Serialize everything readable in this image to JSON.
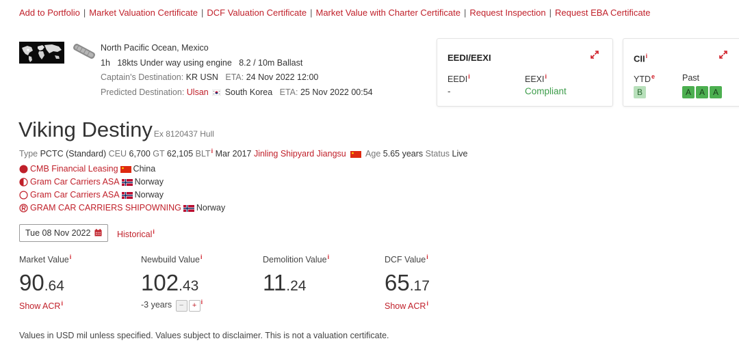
{
  "top_links": [
    "Add to Portfolio",
    "Market Valuation Certificate",
    "DCF Valuation Certificate",
    "Market Value with Charter Certificate",
    "Request Inspection",
    "Request EBA Certificate"
  ],
  "top_links_separator": "|",
  "position": {
    "location": "North Pacific Ocean, Mexico",
    "age": "1h",
    "status_line": "18kts Under way using engine",
    "draught": "8.2 / 10m Ballast",
    "captains_dest_label": "Captain's Destination:",
    "captains_dest_value": "KR USN",
    "captains_eta_label": "ETA:",
    "captains_eta_value": "24 Nov 2022 12:00",
    "predicted_dest_label": "Predicted Destination:",
    "predicted_dest_port": "Ulsan",
    "predicted_dest_country": "South Korea",
    "predicted_eta_label": "ETA:",
    "predicted_eta_value": "25 Nov 2022 00:54"
  },
  "eedi_card": {
    "title": "EEDI/EEXI",
    "eedi_label": "EEDI",
    "eedi_value": "-",
    "eexi_label": "EEXI",
    "eexi_value": "Compliant",
    "compliant_color": "#3d9c4a"
  },
  "cii_card": {
    "title": "CII",
    "ytd_label": "YTD",
    "ytd_grade": "B",
    "past_label": "Past",
    "past_grades": [
      "A",
      "A",
      "A"
    ]
  },
  "vessel": {
    "name": "Viking Destiny",
    "ex_text": "Ex 8120437 Hull",
    "type_label": "Type",
    "type_value": "PCTC (Standard)",
    "ceu_label": "CEU",
    "ceu_value": "6,700",
    "gt_label": "GT",
    "gt_value": "62,105",
    "blt_label": "BLT",
    "blt_value": "Mar 2017",
    "builder": "Jinling Shipyard Jiangsu",
    "age_label": "Age",
    "age_value": "5.65 years",
    "status_label": "Status",
    "status_value": "Live"
  },
  "owners": [
    {
      "role_icon": "registered-owner-icon",
      "name": "CMB Financial Leasing",
      "country": "China",
      "flag": "china-flag"
    },
    {
      "role_icon": "beneficial-owner-icon",
      "name": "Gram Car Carriers ASA",
      "country": "Norway",
      "flag": "norway-flag"
    },
    {
      "role_icon": "operator-icon",
      "name": "Gram Car Carriers ASA",
      "country": "Norway",
      "flag": "norway-flag"
    },
    {
      "role_icon": "manager-icon",
      "name": "GRAM CAR CARRIERS SHIPOWNING",
      "country": "Norway",
      "flag": "norway-flag"
    }
  ],
  "date_selector": {
    "value": "Tue 08 Nov 2022",
    "historical_label": "Historical"
  },
  "values": {
    "market": {
      "label": "Market Value",
      "int": "90",
      "dec": ".64",
      "link": "Show ACR"
    },
    "newbuild": {
      "label": "Newbuild Value",
      "int": "102",
      "dec": ".43",
      "years_text": "-3 years",
      "minus": "−",
      "plus": "+"
    },
    "demolition": {
      "label": "Demolition Value",
      "int": "11",
      "dec": ".24"
    },
    "dcf": {
      "label": "DCF Value",
      "int": "65",
      "dec": ".17",
      "link": "Show ACR"
    }
  },
  "info_marker": "i",
  "ytd_marker": "e",
  "disclaimer": "Values in USD mil unless specified. Values subject to disclaimer. This is not a valuation certificate.",
  "colors": {
    "accent": "#c0202a",
    "grade_light": "#b8e0bb",
    "grade_dark": "#4caf50"
  }
}
